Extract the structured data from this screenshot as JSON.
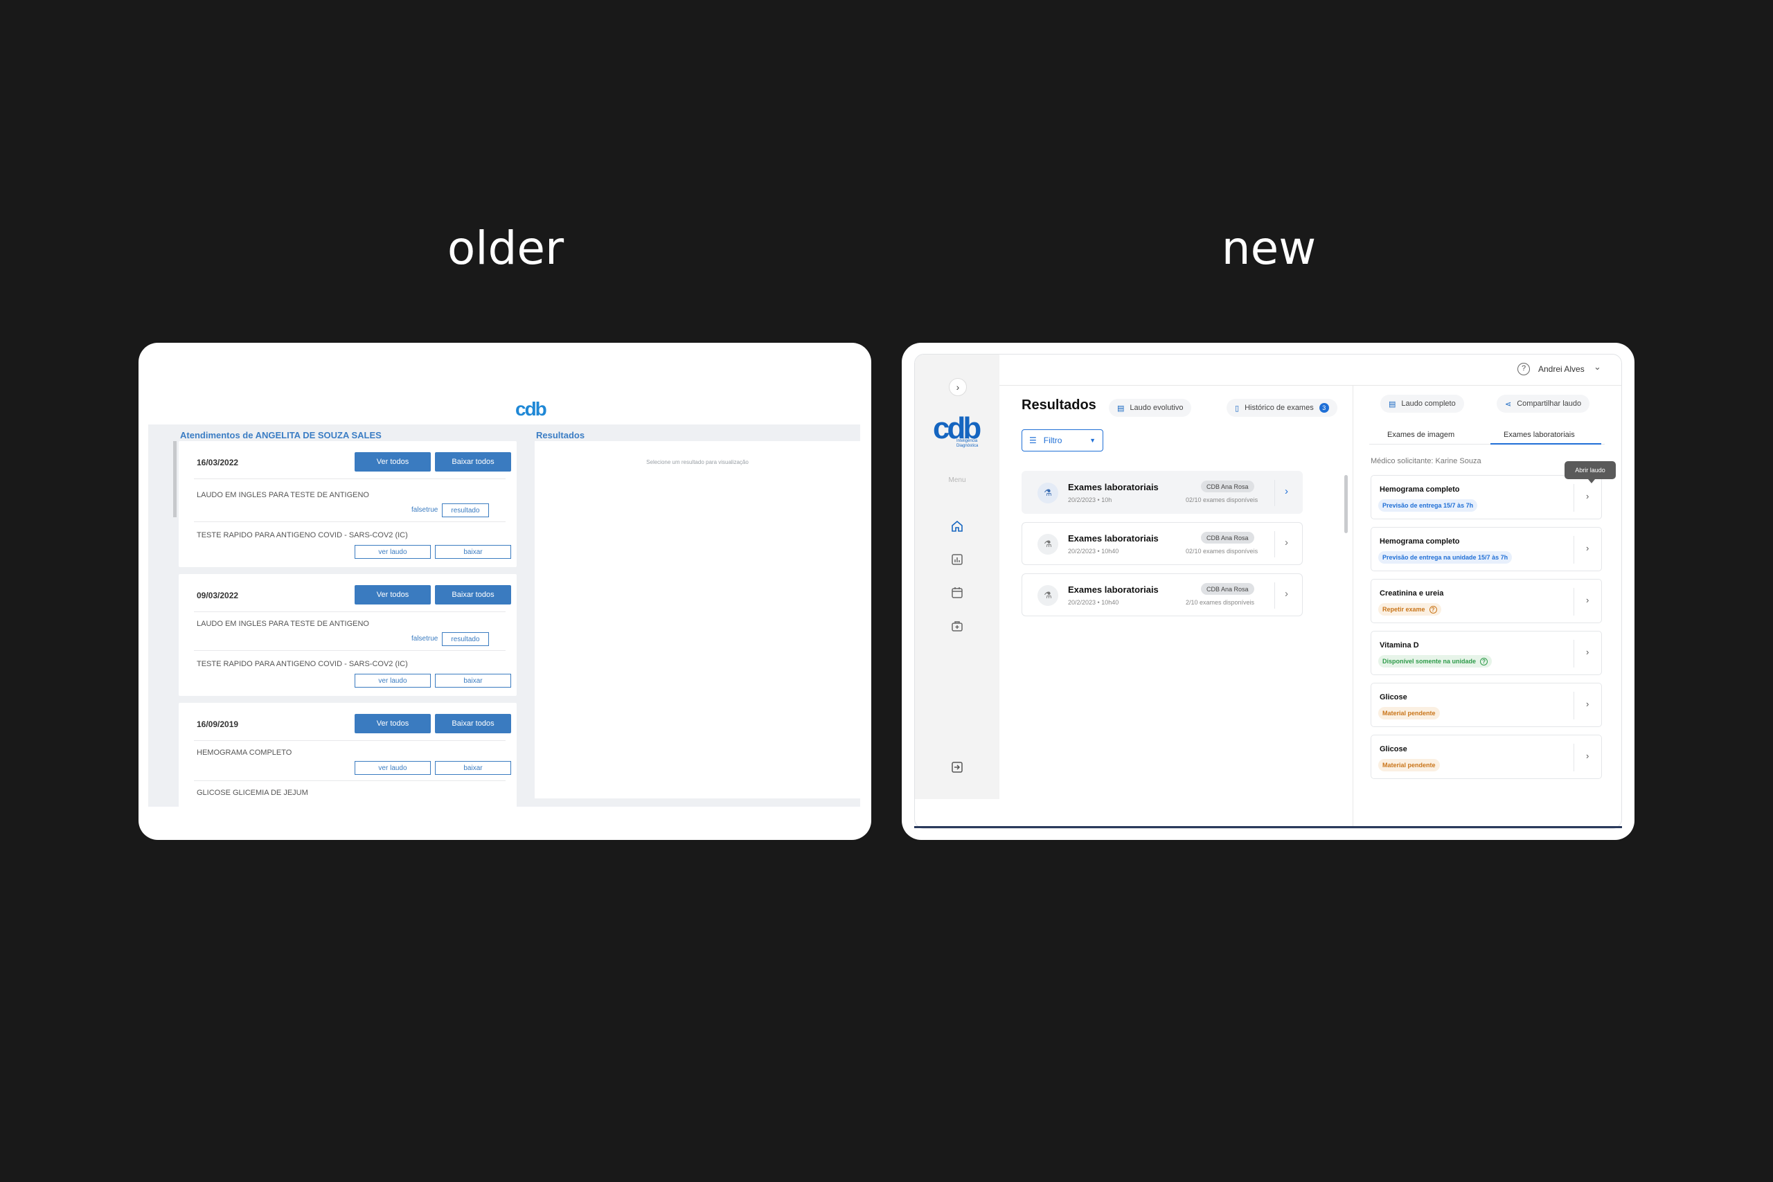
{
  "headings": {
    "left": "older",
    "right": "new"
  },
  "old": {
    "logo": "cdb",
    "left_title": "Atendimentos de ANGELITA DE SOUZA SALES",
    "right_title": "Resultados",
    "panel_hint": "Selecione um resultado para visualização",
    "ver_todos": "Ver todos",
    "baixar_todos": "Baixar todos",
    "groups": [
      {
        "date": "16/03/2022",
        "items": [
          {
            "name": "LAUDO EM INGLES PARA TESTE DE ANTIGENO",
            "link": "falsetrue",
            "btn": "resultado"
          },
          {
            "name": "TESTE RAPIDO PARA ANTIGENO COVID - SARS-COV2 (IC)",
            "btn1": "ver laudo",
            "btn2": "baixar"
          }
        ]
      },
      {
        "date": "09/03/2022",
        "items": [
          {
            "name": "LAUDO EM INGLES PARA TESTE DE ANTIGENO",
            "link": "falsetrue",
            "btn": "resultado"
          },
          {
            "name": "TESTE RAPIDO PARA ANTIGENO COVID - SARS-COV2 (IC)",
            "btn1": "ver laudo",
            "btn2": "baixar"
          }
        ]
      },
      {
        "date": "16/09/2019",
        "items": [
          {
            "name": "HEMOGRAMA COMPLETO",
            "btn1": "ver laudo",
            "btn2": "baixar"
          },
          {
            "name": "GLICOSE GLICEMIA DE JEJUM"
          }
        ]
      }
    ]
  },
  "new": {
    "logo": "cdb",
    "logo_sub": "Inteligência Diagnóstica",
    "menu_label": "Menu",
    "user": "Andrei Alves",
    "title": "Resultados",
    "chip_laudo_evolutivo": "Laudo evolutivo",
    "chip_historico": "Histórico de exames",
    "historico_count": "3",
    "filtro": "Filtro",
    "exams": [
      {
        "title": "Exames laboratoriais",
        "date": "20/2/2023 • 10h",
        "tag": "CDB Ana Rosa",
        "avail": "02/10 exames disponíveis"
      },
      {
        "title": "Exames laboratoriais",
        "date": "20/2/2023 • 10h40",
        "tag": "CDB Ana Rosa",
        "avail": "02/10 exames disponíveis"
      },
      {
        "title": "Exames laboratoriais",
        "date": "20/2/2023 • 10h40",
        "tag": "CDB Ana Rosa",
        "avail": "2/10 exames disponíveis"
      }
    ],
    "chip_laudo_completo": "Laudo completo",
    "chip_compartilhar": "Compartilhar laudo",
    "tab_imagem": "Exames de imagem",
    "tab_lab": "Exames laboratoriais",
    "medico": "Médico solicitante: Karine Souza",
    "tooltip": "Abrir laudo",
    "labs": [
      {
        "title": "Hemograma completo",
        "status": "Previsão de entrega 15/7 às 7h"
      },
      {
        "title": "Hemograma completo",
        "status": "Previsão de entrega na unidade 15/7 às 7h"
      },
      {
        "title": "Creatinina e ureia",
        "status": "Repetir exame"
      },
      {
        "title": "Vitamina D",
        "status": "Disponível somente na unidade"
      },
      {
        "title": "Glicose",
        "status": "Material pendente"
      },
      {
        "title": "Glicose",
        "status": "Material pendente"
      }
    ],
    "colors": {
      "accent": "#1f6fd6",
      "warning": "#c9751a",
      "success": "#2e9b4a"
    }
  }
}
